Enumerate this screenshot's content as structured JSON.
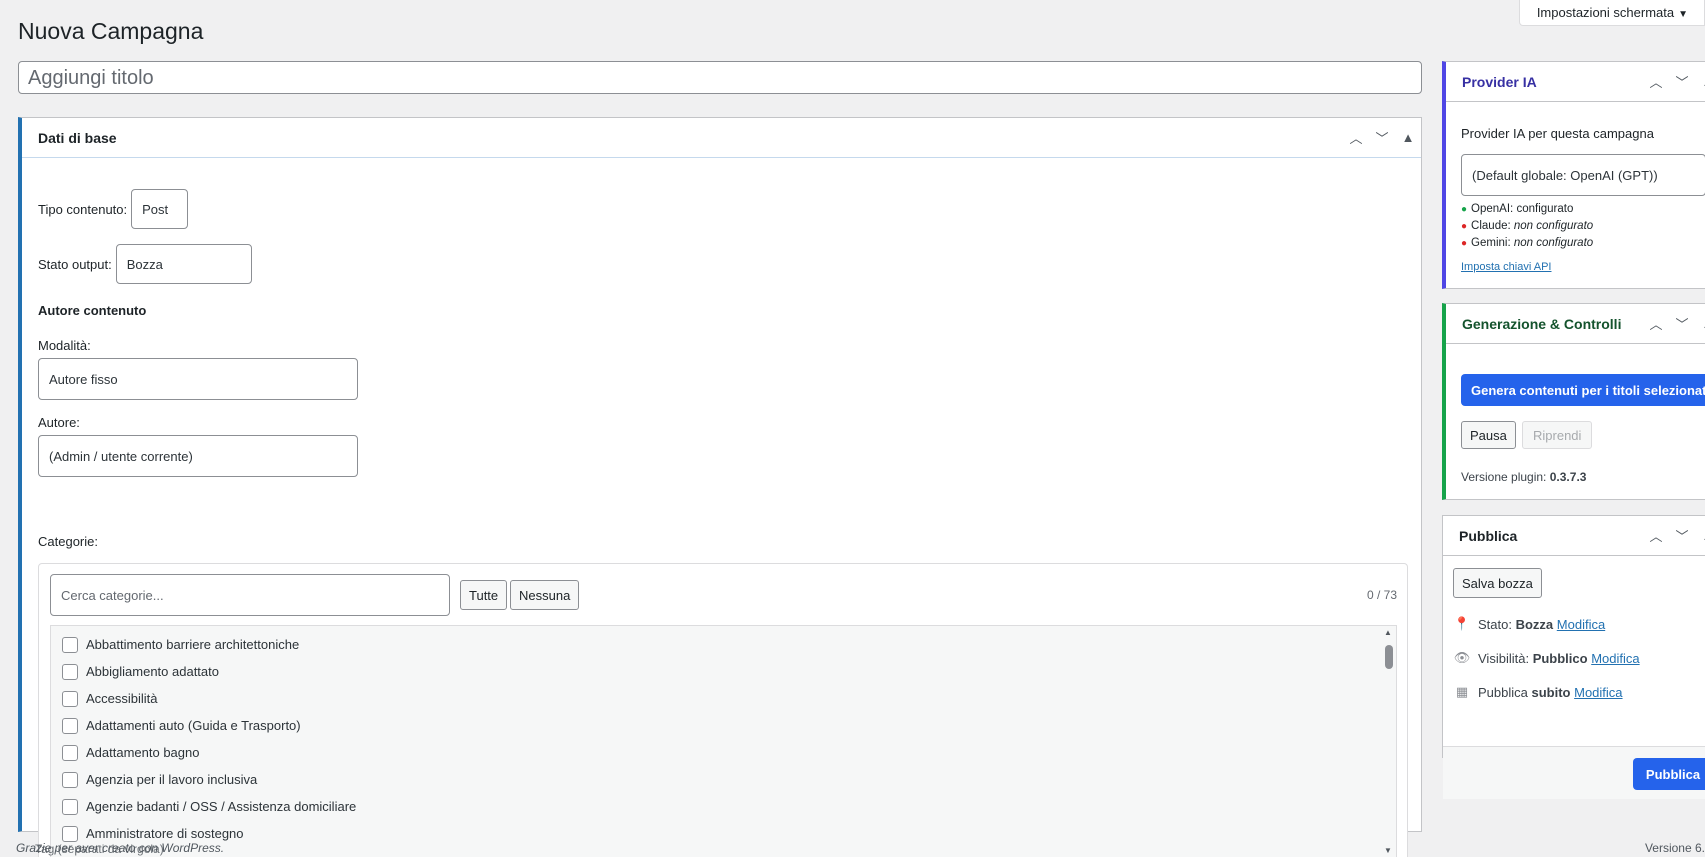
{
  "screen_options": "Impostazioni schermata",
  "page_title": "Nuova Campagna",
  "title_placeholder": "Aggiungi titolo",
  "main_box": {
    "title": "Dati di base",
    "content_type_label": "Tipo contenuto:",
    "content_type_value": "Post",
    "output_state_label": "Stato output:",
    "output_state_value": "Bozza",
    "author_section": "Autore contenuto",
    "mode_label": "Modalità:",
    "mode_value": "Autore fisso",
    "author_label": "Autore:",
    "author_value": "(Admin / utente corrente)",
    "categories_label": "Categorie:",
    "cat_search_placeholder": "Cerca categorie...",
    "btn_all": "Tutte",
    "btn_none": "Nessuna",
    "cat_count": "0 / 73",
    "categories": [
      "Abbattimento barriere architettoniche",
      "Abbigliamento adattato",
      "Accessibilità",
      "Adattamenti auto (Guida e Trasporto)",
      "Adattamento bagno",
      "Agenzia per il lavoro inclusiva",
      "Agenzie badanti / OSS / Assistenza domiciliare",
      "Amministratore di sostegno"
    ]
  },
  "provider": {
    "title": "Provider IA",
    "label": "Provider IA per questa campagna",
    "select_value": "(Default globale: OpenAI (GPT))",
    "status": [
      {
        "name": "OpenAI:",
        "value": "configurato",
        "color": "#16a34a",
        "italic": false
      },
      {
        "name": "Claude:",
        "value": "non configurato",
        "color": "#dc2626",
        "italic": true
      },
      {
        "name": "Gemini:",
        "value": "non configurato",
        "color": "#dc2626",
        "italic": true
      }
    ],
    "api_link": "Imposta chiavi API"
  },
  "generation": {
    "title": "Generazione & Controlli",
    "generate_btn": "Genera contenuti per i titoli selezionati",
    "pause_btn": "Pausa",
    "resume_btn": "Riprendi",
    "version_label": "Versione plugin:",
    "version_value": "0.3.7.3"
  },
  "publish": {
    "title": "Pubblica",
    "save_draft": "Salva bozza",
    "status_label": "Stato:",
    "status_value": "Bozza",
    "visibility_label": "Visibilità:",
    "visibility_value": "Pubblico",
    "schedule_label": "Pubblica",
    "schedule_value": "subito",
    "edit_link": "Modifica",
    "publish_btn": "Pubblica"
  },
  "footer": {
    "thanks": "Grazie per aver creato con WordPress.",
    "tags_note": "Tag (separati da virgola)",
    "version": "Versione 6."
  },
  "colors": {
    "accent": "#2271b1",
    "primary_button": "#2563eb",
    "provider_border": "#4f46e5",
    "generation_border": "#16a34a"
  }
}
